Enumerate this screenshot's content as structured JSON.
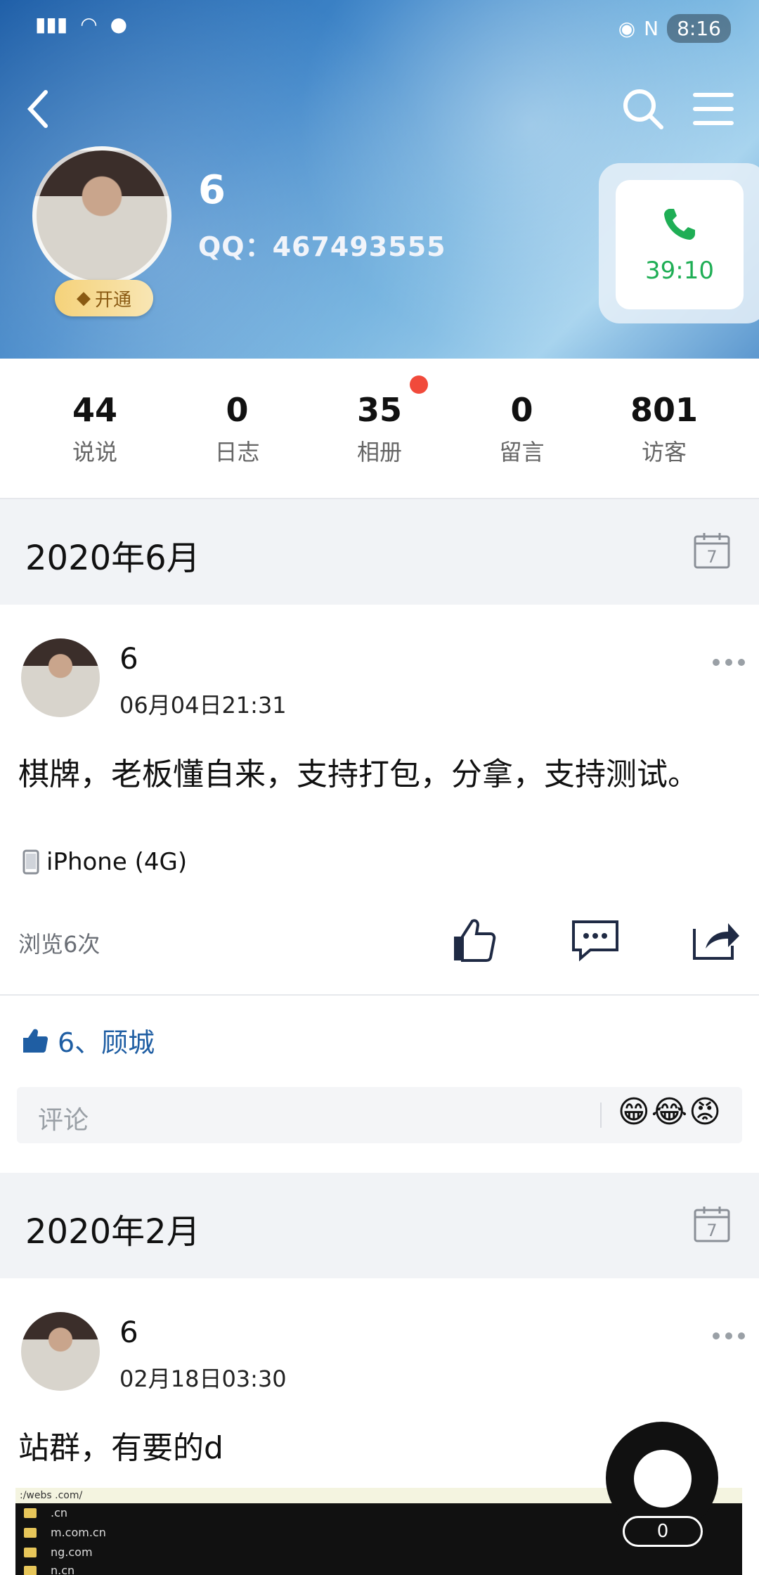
{
  "status_bar": {
    "left": [
      "HD1",
      "HD2",
      "4G",
      "4G",
      "wifi",
      "wechat"
    ],
    "right_time": "8:16"
  },
  "profile": {
    "name": "6",
    "qq": "QQ：467493555",
    "vip_label": "开通",
    "call_time": "39:10"
  },
  "stats": [
    {
      "num": "44",
      "label": "说说"
    },
    {
      "num": "0",
      "label": "日志"
    },
    {
      "num": "35",
      "label": "相册"
    },
    {
      "num": "0",
      "label": "留言"
    },
    {
      "num": "801",
      "label": "访客"
    }
  ],
  "sections": [
    {
      "month": "2020年6月"
    },
    {
      "month": "2020年2月"
    }
  ],
  "posts": [
    {
      "author": "6",
      "time": "06月04日21:31",
      "text": "棋牌，老板懂自来，支持打包，分拿，支持测试。",
      "device": "iPhone (4G)",
      "views": "浏览6次",
      "likes": "6、顾城",
      "comment_placeholder": "评论"
    },
    {
      "author": "6",
      "time": "02月18日03:30",
      "text": "站群，有要的d"
    }
  ],
  "floating": {
    "count": "0"
  },
  "strip": {
    "path": ":/webs                .com/",
    "rows": [
      "   .cn",
      "   m.com.cn",
      "   ng.com",
      "   n.cn"
    ]
  },
  "colors": {
    "accent_green": "#1fae55",
    "link_blue": "#1f5ea3",
    "red_dot": "#f14a3b"
  },
  "icons": [
    "back-icon",
    "search-icon",
    "menu-icon",
    "phone-icon",
    "calendar-icon",
    "like-icon",
    "comment-icon",
    "share-icon",
    "more-icon",
    "device-icon"
  ]
}
